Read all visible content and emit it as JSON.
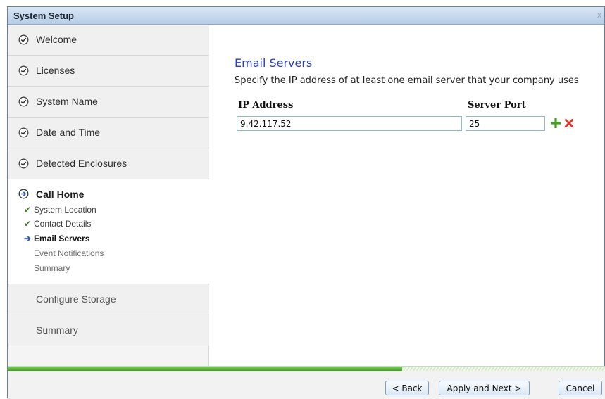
{
  "window": {
    "title": "System Setup",
    "close_glyph": "x"
  },
  "sidebar": {
    "completed_steps": [
      "Welcome",
      "Licenses",
      "System Name",
      "Date and Time",
      "Detected Enclosures"
    ],
    "current_step": {
      "label": "Call Home",
      "substeps": [
        {
          "label": "System Location",
          "state": "done"
        },
        {
          "label": "Contact Details",
          "state": "done"
        },
        {
          "label": "Email Servers",
          "state": "active"
        },
        {
          "label": "Event Notifications",
          "state": "pending"
        },
        {
          "label": "Summary",
          "state": "pending"
        }
      ]
    },
    "future_steps": [
      "Configure Storage",
      "Summary"
    ]
  },
  "main": {
    "section_title": "Email Servers",
    "description": "Specify the IP address of at least one email server that your company uses",
    "columns": {
      "ip": "IP Address",
      "port": "Server Port"
    },
    "row": {
      "ip": "9.42.117.52",
      "port": "25"
    }
  },
  "progress": {
    "fraction": 0.66
  },
  "footer": {
    "back": "< Back",
    "next": "Apply and Next >",
    "cancel": "Cancel"
  },
  "colors": {
    "check": "#3b7a1f",
    "title_blue": "#2b3fb3",
    "progress_green": "#3fa21f"
  },
  "icons": {
    "completed": "check-circle-icon",
    "current": "arrow-circle-icon",
    "add": "plus-icon",
    "delete": "x-icon"
  }
}
